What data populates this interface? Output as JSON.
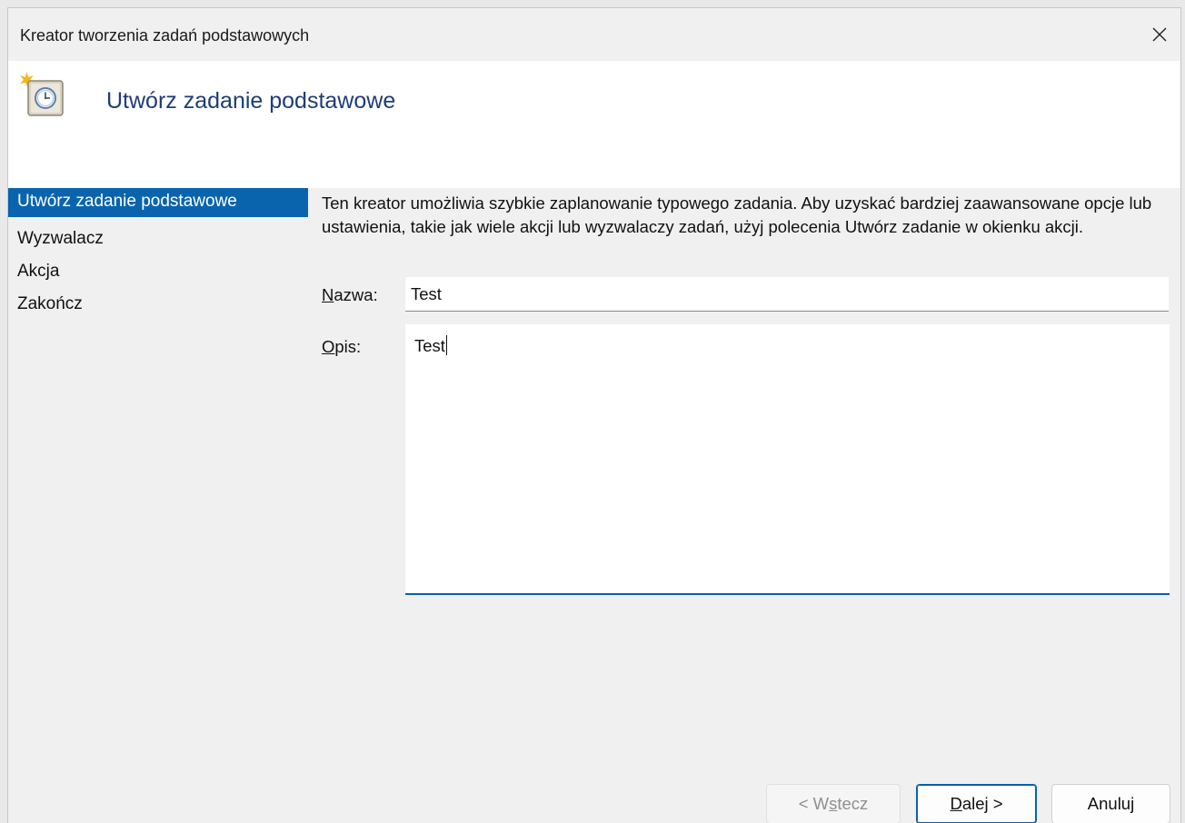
{
  "window": {
    "title": "Kreator tworzenia zadań podstawowych",
    "close_glyph": "✕"
  },
  "header": {
    "title": "Utwórz zadanie podstawowe",
    "icon": "task-scheduler-clock-icon"
  },
  "sidebar": {
    "steps": [
      {
        "label": "Utwórz zadanie podstawowe",
        "active": true
      },
      {
        "label": "Wyzwalacz",
        "active": false
      },
      {
        "label": "Akcja",
        "active": false
      },
      {
        "label": "Zakończ",
        "active": false
      }
    ]
  },
  "content": {
    "intro": "Ten kreator umożliwia szybkie zaplanowanie typowego zadania. Aby uzyskać bardziej zaawansowane opcje lub ustawienia, takie jak wiele akcji lub wyzwalaczy zadań, użyj polecenia Utwórz zadanie w okienku akcji.",
    "name_label_accel": "N",
    "name_label_rest": "azwa:",
    "name_value": "Test",
    "desc_label_accel": "O",
    "desc_label_rest": "pis:",
    "desc_value": "Test"
  },
  "buttons": {
    "back_pre": "< W",
    "back_accel": "s",
    "back_post": "tecz",
    "next_accel": "D",
    "next_post": "alej >",
    "cancel": "Anuluj"
  },
  "colors": {
    "accent": "#0a64ad",
    "header_title": "#1e3c78"
  }
}
